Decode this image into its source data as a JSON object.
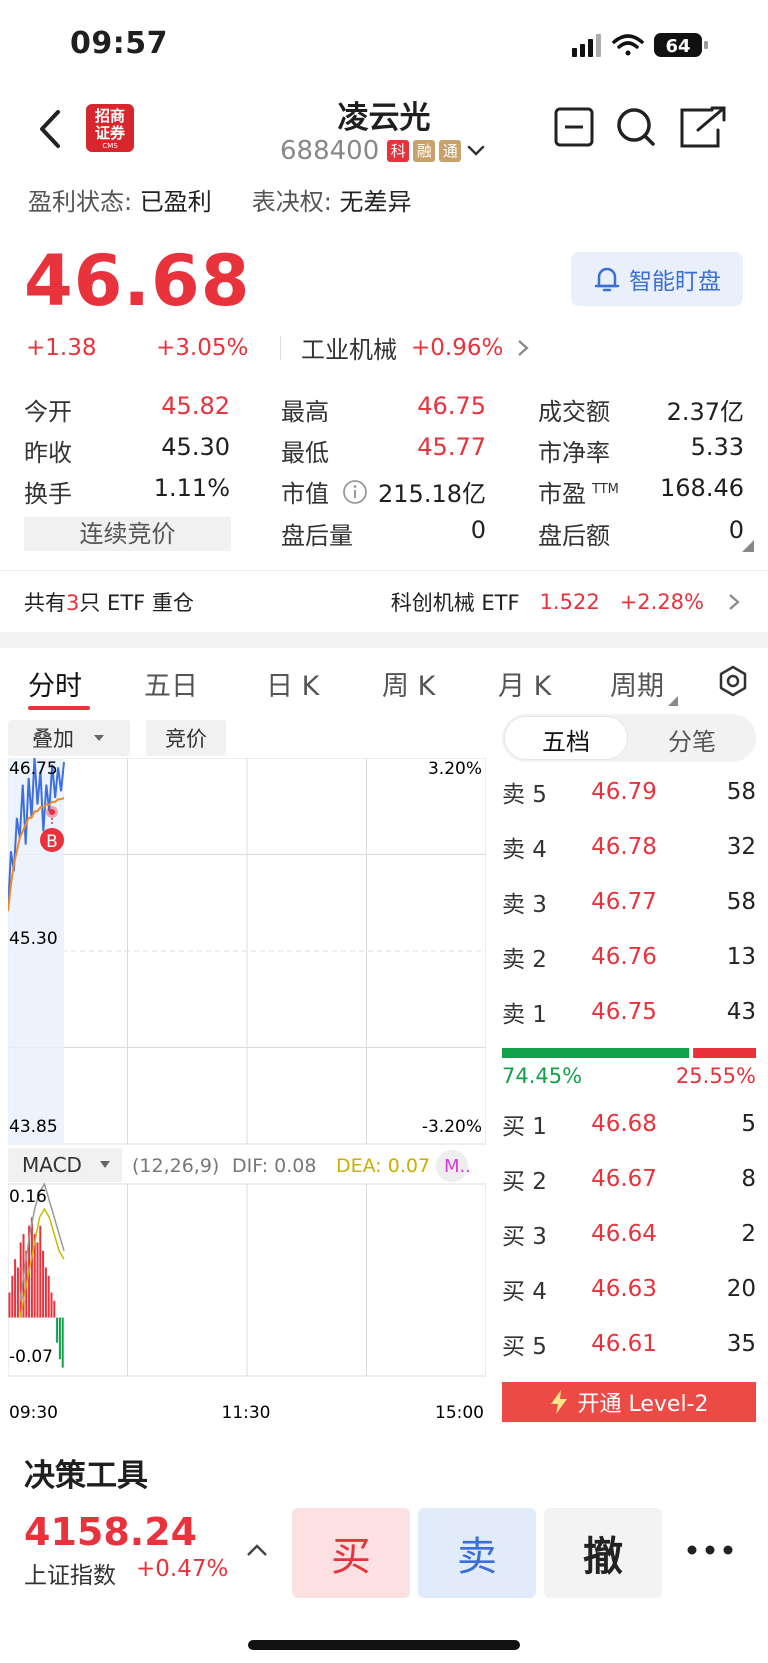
{
  "status": {
    "time": "09:57",
    "battery": "64"
  },
  "header": {
    "broker_logo_top": "招商",
    "broker_logo_bottom": "证券",
    "broker_logo_sub": "CMS",
    "stock_name": "凌云光",
    "stock_code": "688400",
    "tags": [
      "科",
      "融",
      "通"
    ]
  },
  "profit": {
    "profit_label": "盈利状态:",
    "profit_value": "已盈利",
    "vote_label": "表决权:",
    "vote_value": "无差异"
  },
  "price": {
    "current": "46.68",
    "change_abs": "+1.38",
    "change_pct": "+3.05%",
    "industry": "工业机械",
    "industry_change": "+0.96%",
    "smart_watch_label": "智能盯盘"
  },
  "quote": {
    "open_label": "今开",
    "open_value": "45.82",
    "high_label": "最高",
    "high_value": "46.75",
    "turnover_label": "成交额",
    "turnover_value": "2.37亿",
    "prev_close_label": "昨收",
    "prev_close_value": "45.30",
    "low_label": "最低",
    "low_value": "45.77",
    "pb_label": "市净率",
    "pb_value": "5.33",
    "turnover_rate_label": "换手",
    "turnover_rate_value": "1.11%",
    "mcap_label": "市值",
    "mcap_value": "215.18亿",
    "pe_label": "市盈",
    "pe_sup": "TTM",
    "pe_value": "168.46",
    "auction_label": "连续竞价",
    "after_vol_label": "盘后量",
    "after_vol_value": "0",
    "after_amt_label": "盘后额",
    "after_amt_value": "0"
  },
  "etf": {
    "prefix": "共有",
    "count": "3",
    "suffix": "只 ETF 重仓",
    "name": "科创机械 ETF",
    "price": "1.522",
    "change": "+2.28%"
  },
  "tabs": [
    "分时",
    "五日",
    "日 K",
    "周 K",
    "月 K",
    "周期"
  ],
  "chart_controls": {
    "overlay": "叠加",
    "auction": "竞价"
  },
  "chart_data": {
    "type": "line",
    "price_axis": {
      "top": "46.75",
      "mid": "45.30",
      "bottom": "43.85"
    },
    "pct_axis": {
      "top": "3.20%",
      "bottom": "-3.20%"
    },
    "time_ticks": [
      "09:30",
      "11:30",
      "15:00"
    ],
    "buy_marker": "B",
    "indicator": {
      "name": "MACD",
      "params": "(12,26,9)",
      "dif": "DIF: 0.08",
      "dea": "DEA: 0.07",
      "macd": "M..",
      "ymax": "0.16",
      "ymin": "-0.07"
    },
    "price_series": [
      45.6,
      46.05,
      45.9,
      46.3,
      46.15,
      46.55,
      46.1,
      46.6,
      46.3,
      46.75,
      46.4,
      46.65,
      46.2,
      46.55,
      46.35,
      46.7,
      46.45,
      46.68,
      46.5,
      46.72
    ],
    "avg_series": [
      45.6,
      45.8,
      45.95,
      46.05,
      46.15,
      46.2,
      46.25,
      46.3,
      46.3,
      46.35,
      46.35,
      46.38,
      46.38,
      46.4,
      46.4,
      46.42,
      46.42,
      46.44,
      46.44,
      46.45
    ],
    "macd_bars": [
      0.03,
      0.05,
      0.07,
      0.06,
      0.09,
      0.1,
      0.08,
      0.11,
      0.12,
      0.1,
      0.09,
      0.11,
      0.08,
      0.06,
      0.05,
      0.03,
      0.02,
      -0.03,
      -0.05,
      -0.06
    ]
  },
  "orderbook": {
    "tabs": [
      "五档",
      "分笔"
    ],
    "asks": [
      {
        "label": "卖 5",
        "price": "46.79",
        "qty": "58"
      },
      {
        "label": "卖 4",
        "price": "46.78",
        "qty": "32"
      },
      {
        "label": "卖 3",
        "price": "46.77",
        "qty": "58"
      },
      {
        "label": "卖 2",
        "price": "46.76",
        "qty": "13"
      },
      {
        "label": "卖 1",
        "price": "46.75",
        "qty": "43"
      }
    ],
    "buy_ratio": "74.45%",
    "sell_ratio": "25.55%",
    "buy_ratio_value": 0.7445,
    "bids": [
      {
        "label": "买 1",
        "price": "46.68",
        "qty": "5"
      },
      {
        "label": "买 2",
        "price": "46.67",
        "qty": "8"
      },
      {
        "label": "买 3",
        "price": "46.64",
        "qty": "2"
      },
      {
        "label": "买 4",
        "price": "46.63",
        "qty": "20"
      },
      {
        "label": "买 5",
        "price": "46.61",
        "qty": "35"
      }
    ],
    "level2_label": "开通 Level-2"
  },
  "bottom": {
    "tools_title": "决策工具",
    "index_value": "4158.24",
    "index_name": "上证指数",
    "index_change": "+0.47%",
    "buy": "买",
    "sell": "卖",
    "cancel": "撤",
    "more": "···"
  },
  "colors": {
    "up": "#e8323c",
    "down": "#12a14b",
    "accent": "#3a6fd6"
  }
}
